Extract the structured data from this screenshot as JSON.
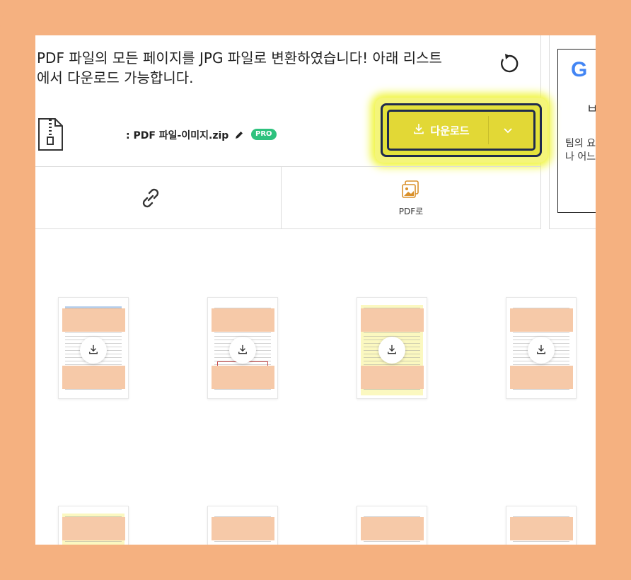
{
  "message": {
    "line1": "PDF 파일의 모든 페이지를 JPG 파일로 변환하였습니다! 아래 리스트",
    "line2": "에서 다운로드 가능합니다."
  },
  "file": {
    "name": ": PDF 파일-이미지.zip",
    "badge": "PRO"
  },
  "download": {
    "label": "다운로드"
  },
  "tools": {
    "link_icon": "link-icon",
    "pdf_label": "PDF로"
  },
  "ad": {
    "brand": "G",
    "line1": "ㅂ",
    "line2": "팀의 요",
    "line3": "나 어느"
  },
  "colors": {
    "accent": "#e2d836",
    "pro_badge": "#2ec27e",
    "highlight": "#f0f53b",
    "redaction": "#f6c9a8"
  }
}
